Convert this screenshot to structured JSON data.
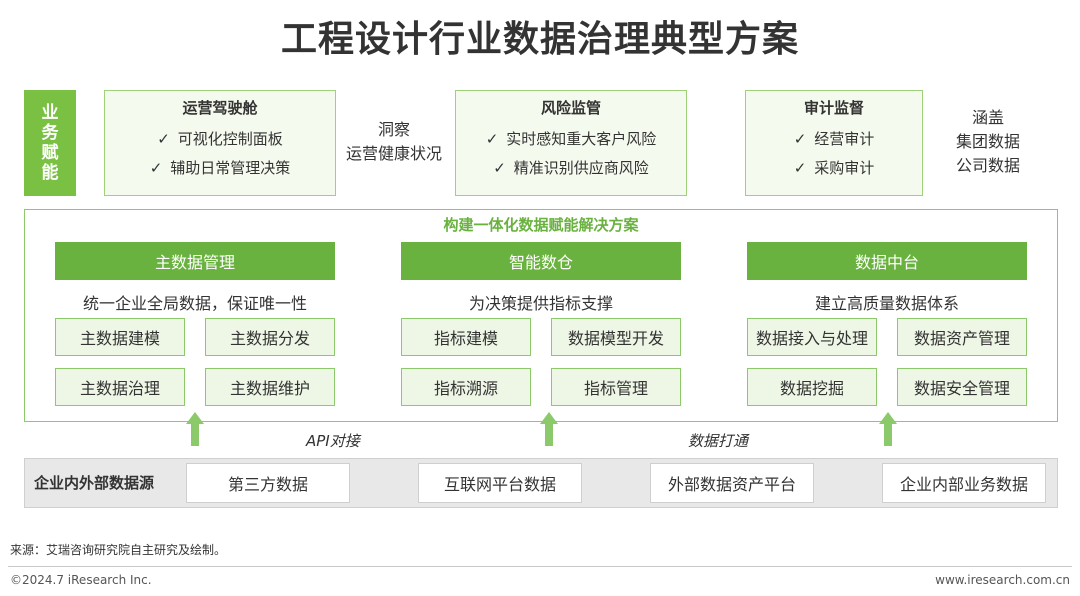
{
  "title": "工程设计行业数据治理典型方案",
  "business": {
    "tag": "业务赋能",
    "cards": [
      {
        "head": "运营驾驶舱",
        "items": [
          "可视化控制面板",
          "辅助日常管理决策"
        ]
      },
      {
        "head": "风险监管",
        "items": [
          "实时感知重大客户风险",
          "精准识别供应商风险"
        ]
      },
      {
        "head": "审计监督",
        "items": [
          "经营审计",
          "采购审计"
        ]
      }
    ],
    "notes": {
      "middle": [
        "洞察",
        "运营健康状况"
      ],
      "right": [
        "涵盖",
        "集团数据",
        "公司数据"
      ]
    },
    "check_icon": "check-icon"
  },
  "solution": {
    "title": "构建一体化数据赋能解决方案",
    "columns": [
      {
        "head": "主数据管理",
        "desc": "统一企业全局数据，保证唯一性",
        "items": [
          "主数据建模",
          "主数据分发",
          "主数据治理",
          "主数据维护"
        ]
      },
      {
        "head": "智能数仓",
        "desc": "为决策提供指标支撑",
        "items": [
          "指标建模",
          "数据模型开发",
          "指标溯源",
          "指标管理"
        ]
      },
      {
        "head": "数据中台",
        "desc": "建立高质量数据体系",
        "items": [
          "数据接入与处理",
          "数据资产管理",
          "数据挖掘",
          "数据安全管理"
        ]
      }
    ]
  },
  "connectors": {
    "left": "API对接",
    "right": "数据打通",
    "arrow_icon": "up-arrow-icon",
    "arrow_color": "#8cc96b"
  },
  "sources": {
    "label": "企业内外部数据源",
    "items": [
      "第三方数据",
      "互联网平台数据",
      "外部数据资产平台",
      "企业内部业务数据"
    ]
  },
  "footer": {
    "source": "来源：艾瑞咨询研究院自主研究及绘制。",
    "copyright": "©2024.7 iResearch Inc.",
    "url": "www.iresearch.com.cn"
  },
  "colors": {
    "accent": "#6ab23f",
    "light_green": "#7ac143",
    "border": "#8cc96b"
  }
}
